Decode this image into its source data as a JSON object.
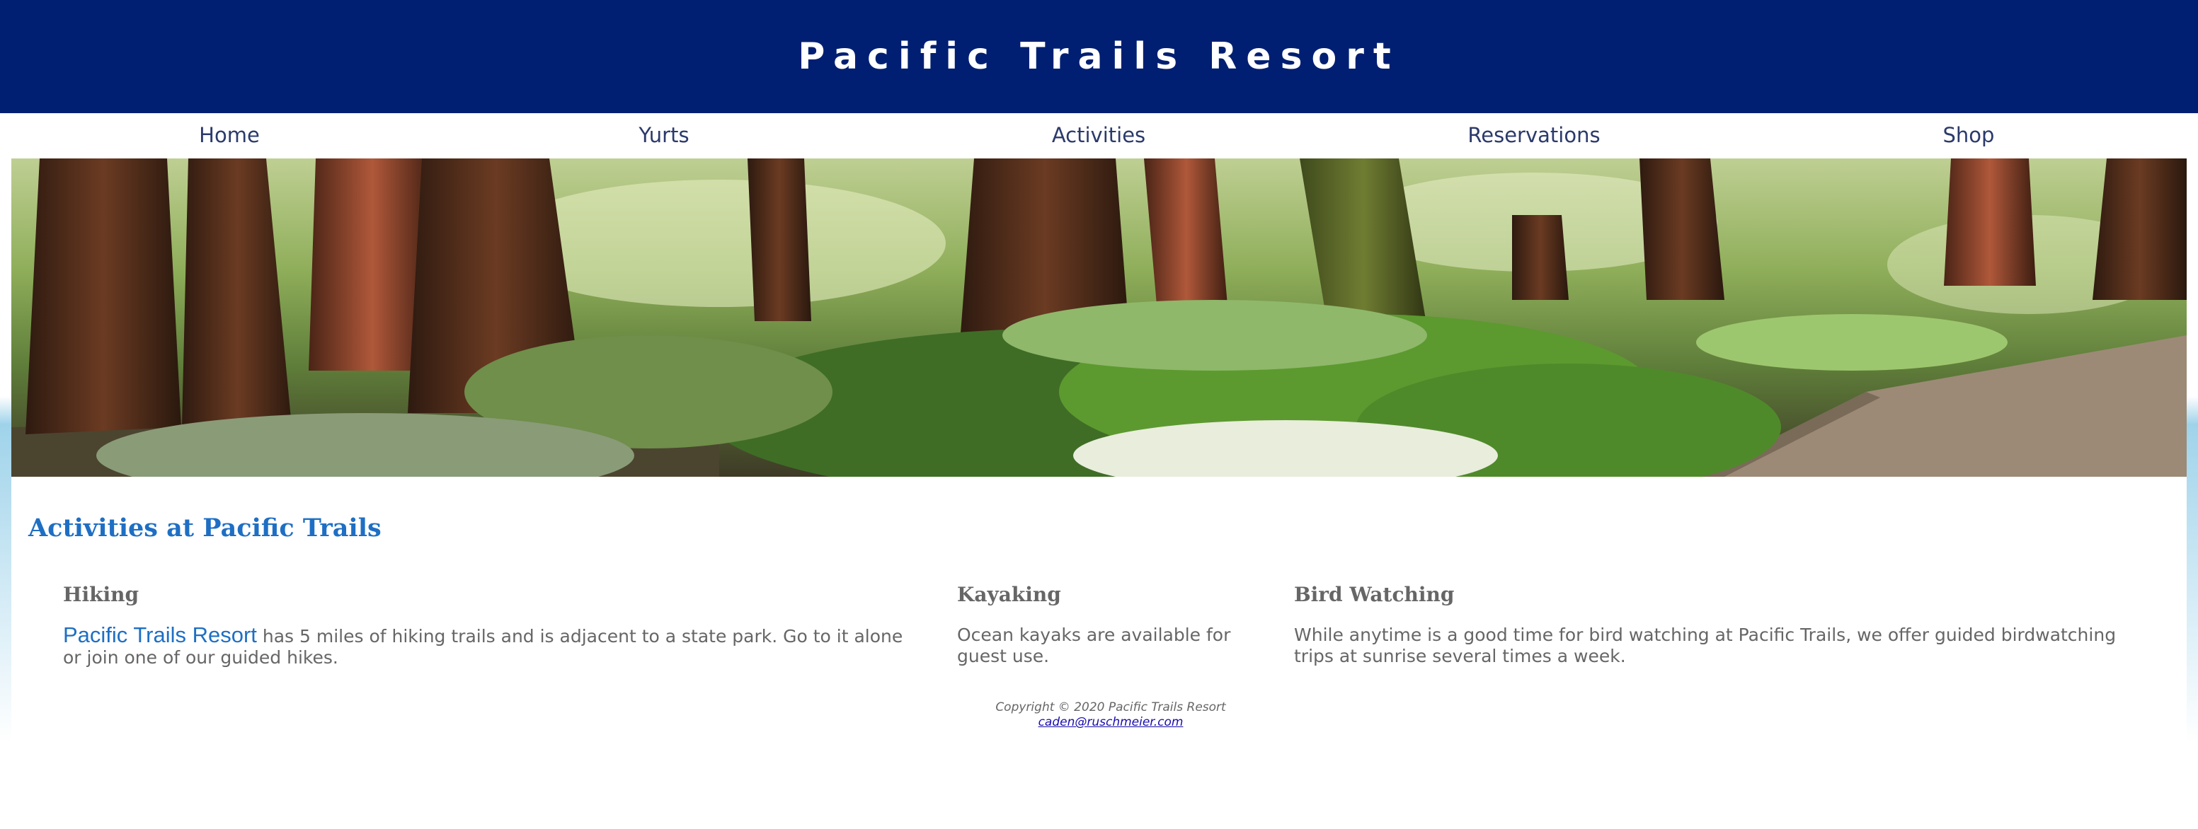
{
  "header": {
    "title": "Pacific Trails Resort"
  },
  "nav": {
    "items": [
      {
        "label": "Home"
      },
      {
        "label": "Yurts"
      },
      {
        "label": "Activities"
      },
      {
        "label": "Reservations"
      },
      {
        "label": "Shop"
      }
    ]
  },
  "hero": {
    "image": "redwood-forest-trail"
  },
  "main": {
    "heading": "Activities at Pacific Trails",
    "sections": [
      {
        "title": "Hiking",
        "link_text": "Pacific Trails Resort",
        "text": " has 5 miles of hiking trails and is adjacent to a state park. Go to it alone or join one of our guided hikes."
      },
      {
        "title": "Kayaking",
        "text": "Ocean kayaks are available for guest use."
      },
      {
        "title": "Bird Watching",
        "text": "While anytime is a good time for bird watching at Pacific Trails, we offer guided birdwatching trips at sunrise several times a week."
      }
    ]
  },
  "footer": {
    "copyright": "Copyright © 2020 Pacific Trails Resort",
    "email": "caden@ruschmeier.com"
  },
  "colors": {
    "header_bg": "#001f72",
    "accent_blue": "#1e6fc4",
    "nav_text": "#2b3a6b",
    "body_text": "#666666"
  }
}
